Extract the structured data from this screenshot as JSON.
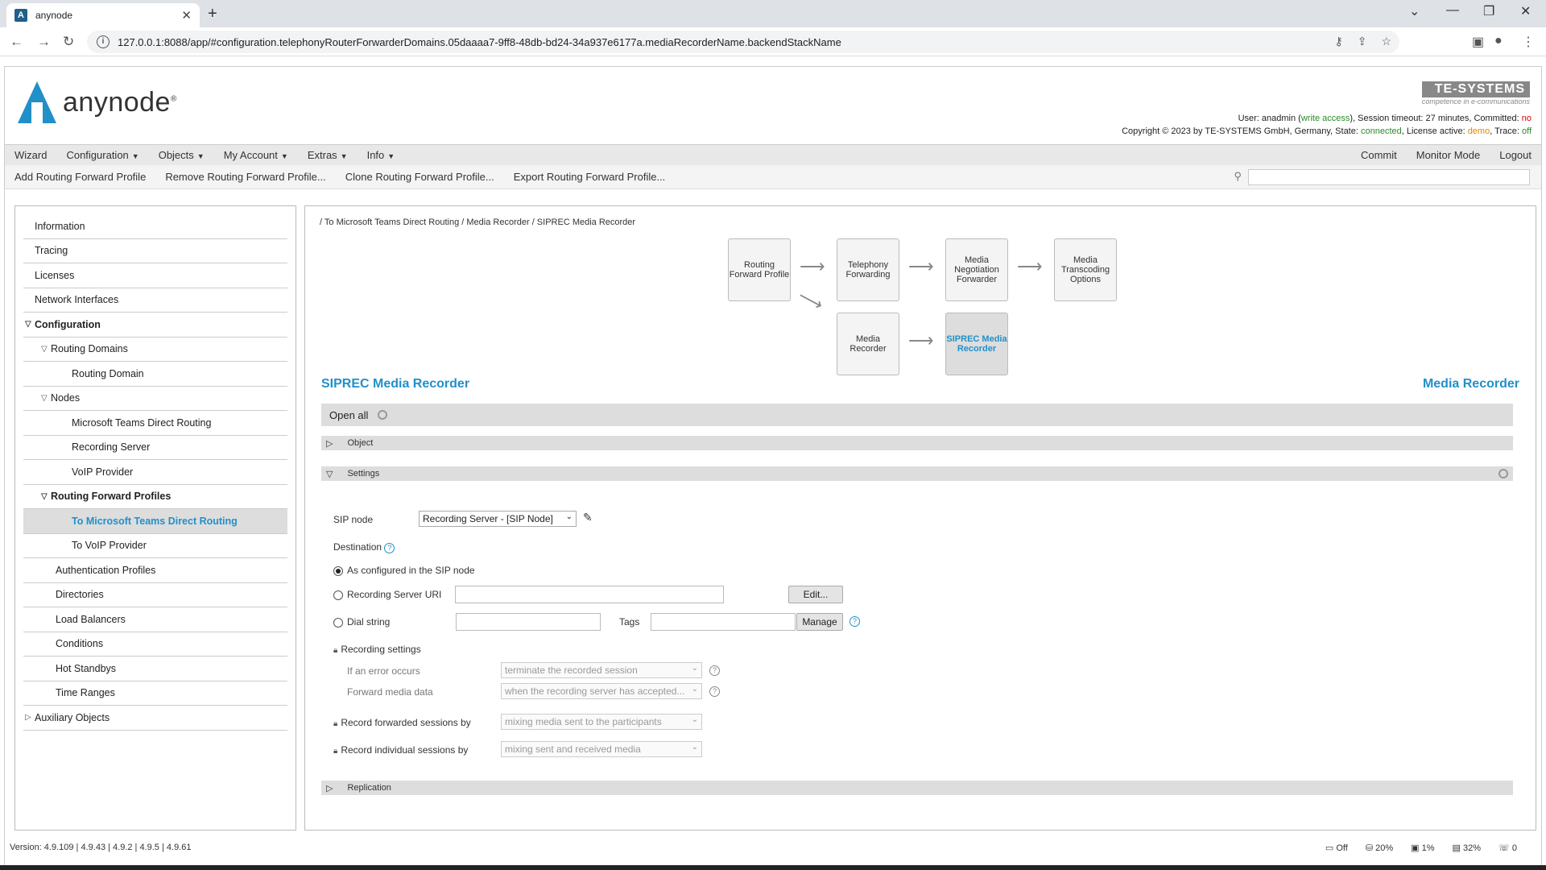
{
  "browser": {
    "tab_title": "anynode",
    "url": "127.0.0.1:8088/app/#configuration.telephonyRouterForwarderDomains.05daaaa7-9ff8-48db-bd24-34a937e6177a.mediaRecorderName.backendStackName"
  },
  "header": {
    "logo_text": "anynode",
    "brand": "TE-SYSTEMS",
    "brand_tag": "competence in e-communications",
    "user_line_prefix": "User: anadmin (",
    "user_access": "write access",
    "user_line_mid": "), Session timeout: 27 minutes, Committed: ",
    "committed": "no",
    "copyright_prefix": "Copyright © 2023 by TE-SYSTEMS GmbH, Germany, State: ",
    "state": "connected",
    "license_prefix": ", License active: ",
    "license": "demo",
    "trace_prefix": ", Trace: ",
    "trace": "off"
  },
  "menu": {
    "left": [
      "Wizard",
      "Configuration",
      "Objects",
      "My Account",
      "Extras",
      "Info"
    ],
    "right": [
      "Commit",
      "Monitor Mode",
      "Logout"
    ]
  },
  "toolbar": [
    "Add Routing Forward Profile",
    "Remove Routing Forward Profile...",
    "Clone Routing Forward Profile...",
    "Export Routing Forward Profile..."
  ],
  "sidebar": {
    "items": [
      {
        "label": "Information"
      },
      {
        "label": "Tracing"
      },
      {
        "label": "Licenses"
      },
      {
        "label": "Network Interfaces"
      },
      {
        "label": "Configuration"
      },
      {
        "label": "Routing Domains"
      },
      {
        "label": "Routing Domain"
      },
      {
        "label": "Nodes"
      },
      {
        "label": "Microsoft Teams Direct Routing"
      },
      {
        "label": "Recording Server"
      },
      {
        "label": "VoIP Provider"
      },
      {
        "label": "Routing Forward Profiles"
      },
      {
        "label": "To Microsoft Teams Direct Routing"
      },
      {
        "label": "To VoIP Provider"
      },
      {
        "label": "Authentication Profiles"
      },
      {
        "label": "Directories"
      },
      {
        "label": "Load Balancers"
      },
      {
        "label": "Conditions"
      },
      {
        "label": "Hot Standbys"
      },
      {
        "label": "Time Ranges"
      },
      {
        "label": "Auxiliary Objects"
      }
    ]
  },
  "main": {
    "breadcrumb": "/ To Microsoft Teams Direct Routing / Media Recorder / SIPREC Media Recorder",
    "flow": {
      "routing_forward_profile": "Routing Forward Profile",
      "telephony_forwarding": "Telephony Forwarding",
      "media_negotiation_forwarder": "Media Negotiation Forwarder",
      "media_transcoding_options": "Media Transcoding Options",
      "media_recorder": "Media Recorder",
      "siprec_media_recorder": "SIPREC Media Recorder"
    },
    "title": "SIPREC Media Recorder",
    "title_right": "Media Recorder",
    "open_all": "Open all",
    "sections": {
      "object": "Object",
      "settings": "Settings",
      "replication": "Replication"
    },
    "form": {
      "sip_node_label": "SIP node",
      "sip_node_value": "Recording Server - [SIP Node]",
      "destination_label": "Destination",
      "opt_configured": "As configured in the SIP node",
      "opt_uri": "Recording Server URI",
      "edit_button": "Edit...",
      "opt_dial": "Dial string",
      "tags_label": "Tags",
      "manage_button": "Manage",
      "recording_settings": "Recording settings",
      "error_label": "If an error occurs",
      "error_value": "terminate the recorded session",
      "forward_label": "Forward media data",
      "forward_value": "when the recording server has accepted...",
      "record_fwd_label": "Record forwarded sessions by",
      "record_fwd_value": "mixing media sent to the participants",
      "record_ind_label": "Record individual sessions by",
      "record_ind_value": "mixing sent and received media"
    }
  },
  "footer": {
    "version": "Version:  4.9.109  |  4.9.43  |  4.9.2  |  4.9.5  |  4.9.61",
    "stats": [
      "Off",
      "20%",
      "1%",
      "32%",
      "0"
    ]
  }
}
